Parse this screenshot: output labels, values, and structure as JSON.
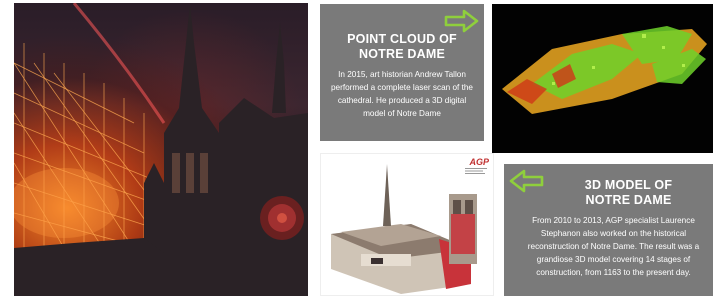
{
  "panel_point_cloud": {
    "title_line1": "POINT CLOUD OF",
    "title_line2": "NOTRE DAME",
    "body": "In 2015, art historian Andrew Tallon performed a complete laser scan of the cathedral. He produced a 3D digital model of Notre Dame"
  },
  "panel_3d_model": {
    "title_line1": "3D MODEL OF",
    "title_line2": "NOTRE DAME",
    "body": "From 2010 to 2013, AGP specialist Laurence Stephanon also worked on the historical reconstruction of Notre Dame. The result was a grandiose 3D model covering 14 stages of construction, from 1163 to the present day."
  },
  "logo": {
    "mark": "AGP"
  },
  "colors": {
    "panel_bg": "#7a7a7a",
    "arrow_green": "#8fcf3c",
    "point_cloud_green": "#6fd22a",
    "point_cloud_orange": "#e0a020",
    "model_red": "#c8333a"
  },
  "icons": {
    "arrow_right": "arrow-right-icon",
    "arrow_left": "arrow-left-icon"
  }
}
